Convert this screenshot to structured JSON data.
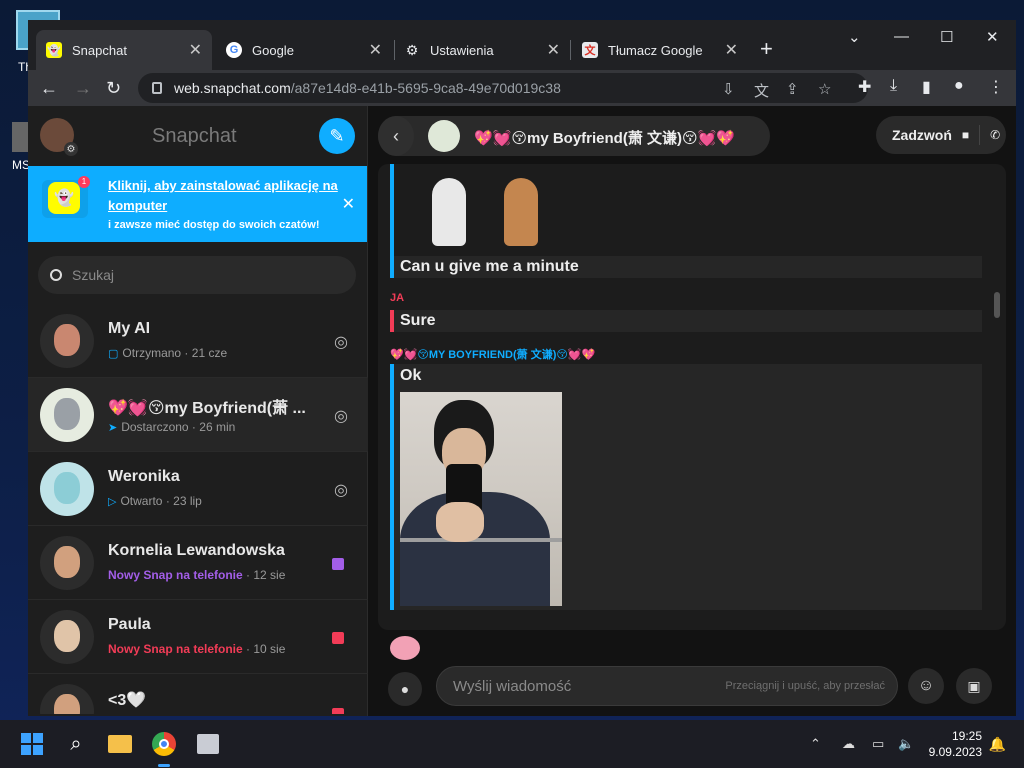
{
  "desktop": {
    "icon_label_1": "Th",
    "icon_label_2": "MS"
  },
  "browser": {
    "tabs": [
      {
        "label": "Snapchat",
        "favicon": "snapchat-icon"
      },
      {
        "label": "Google",
        "favicon": "google-icon"
      },
      {
        "label": "Ustawienia",
        "favicon": "gear-icon"
      },
      {
        "label": "Tłumacz Google",
        "favicon": "translate-icon"
      }
    ],
    "url_host": "web.snapchat.com",
    "url_path": "/a87e14d8-e41b-5695-9ca8-49e70d019c38"
  },
  "sidebar": {
    "title": "Snapchat",
    "banner": {
      "link": "Kliknij, aby zainstalować aplikację na komputer",
      "sub": "i zawsze mieć dostęp do swoich czatów!"
    },
    "search_placeholder": "Szukaj",
    "chats": [
      {
        "name": "My AI",
        "status": "Otrzymano",
        "time": "21 cze",
        "status_color": "#9a9a9a",
        "right": "camera-icon"
      },
      {
        "name": "💖💓😚my Boyfriend(萧 ...",
        "status": "Dostarczono",
        "time": "26 min",
        "status_color": "#9a9a9a",
        "right": "camera-icon"
      },
      {
        "name": "Weronika",
        "status": "Otwarto",
        "time": "23 lip",
        "status_color": "#9a9a9a",
        "right": "camera-icon"
      },
      {
        "name": "Kornelia Lewandowska",
        "status": "Nowy Snap na telefonie",
        "time": "12 sie",
        "status_color": "#a35ee8",
        "right": "purple-square"
      },
      {
        "name": "Paula",
        "status": "Nowy Snap na telefonie",
        "time": "10 sie",
        "status_color": "#f23c57",
        "right": "red-square"
      },
      {
        "name": "<3🤍",
        "status": "",
        "time": "",
        "status_color": "#f23c57",
        "right": "red-square"
      }
    ]
  },
  "chat": {
    "header_name": "💖💓😚my Boyfriend(萧 文谦)😚💓💖",
    "call_label": "Zadzwoń",
    "messages": [
      {
        "text": "Can u give me a minute"
      },
      {
        "sender": "JA",
        "text": "Sure"
      },
      {
        "sender": "💖💓😚MY BOYFRIEND(萧 文谦)😚💓💖",
        "text": "Ok"
      }
    ],
    "input_placeholder": "Wyślij wiadomość",
    "drop_hint": "Przeciągnij i upuść, aby przesłać"
  },
  "taskbar": {
    "time": "19:25",
    "date": "9.09.2023"
  }
}
